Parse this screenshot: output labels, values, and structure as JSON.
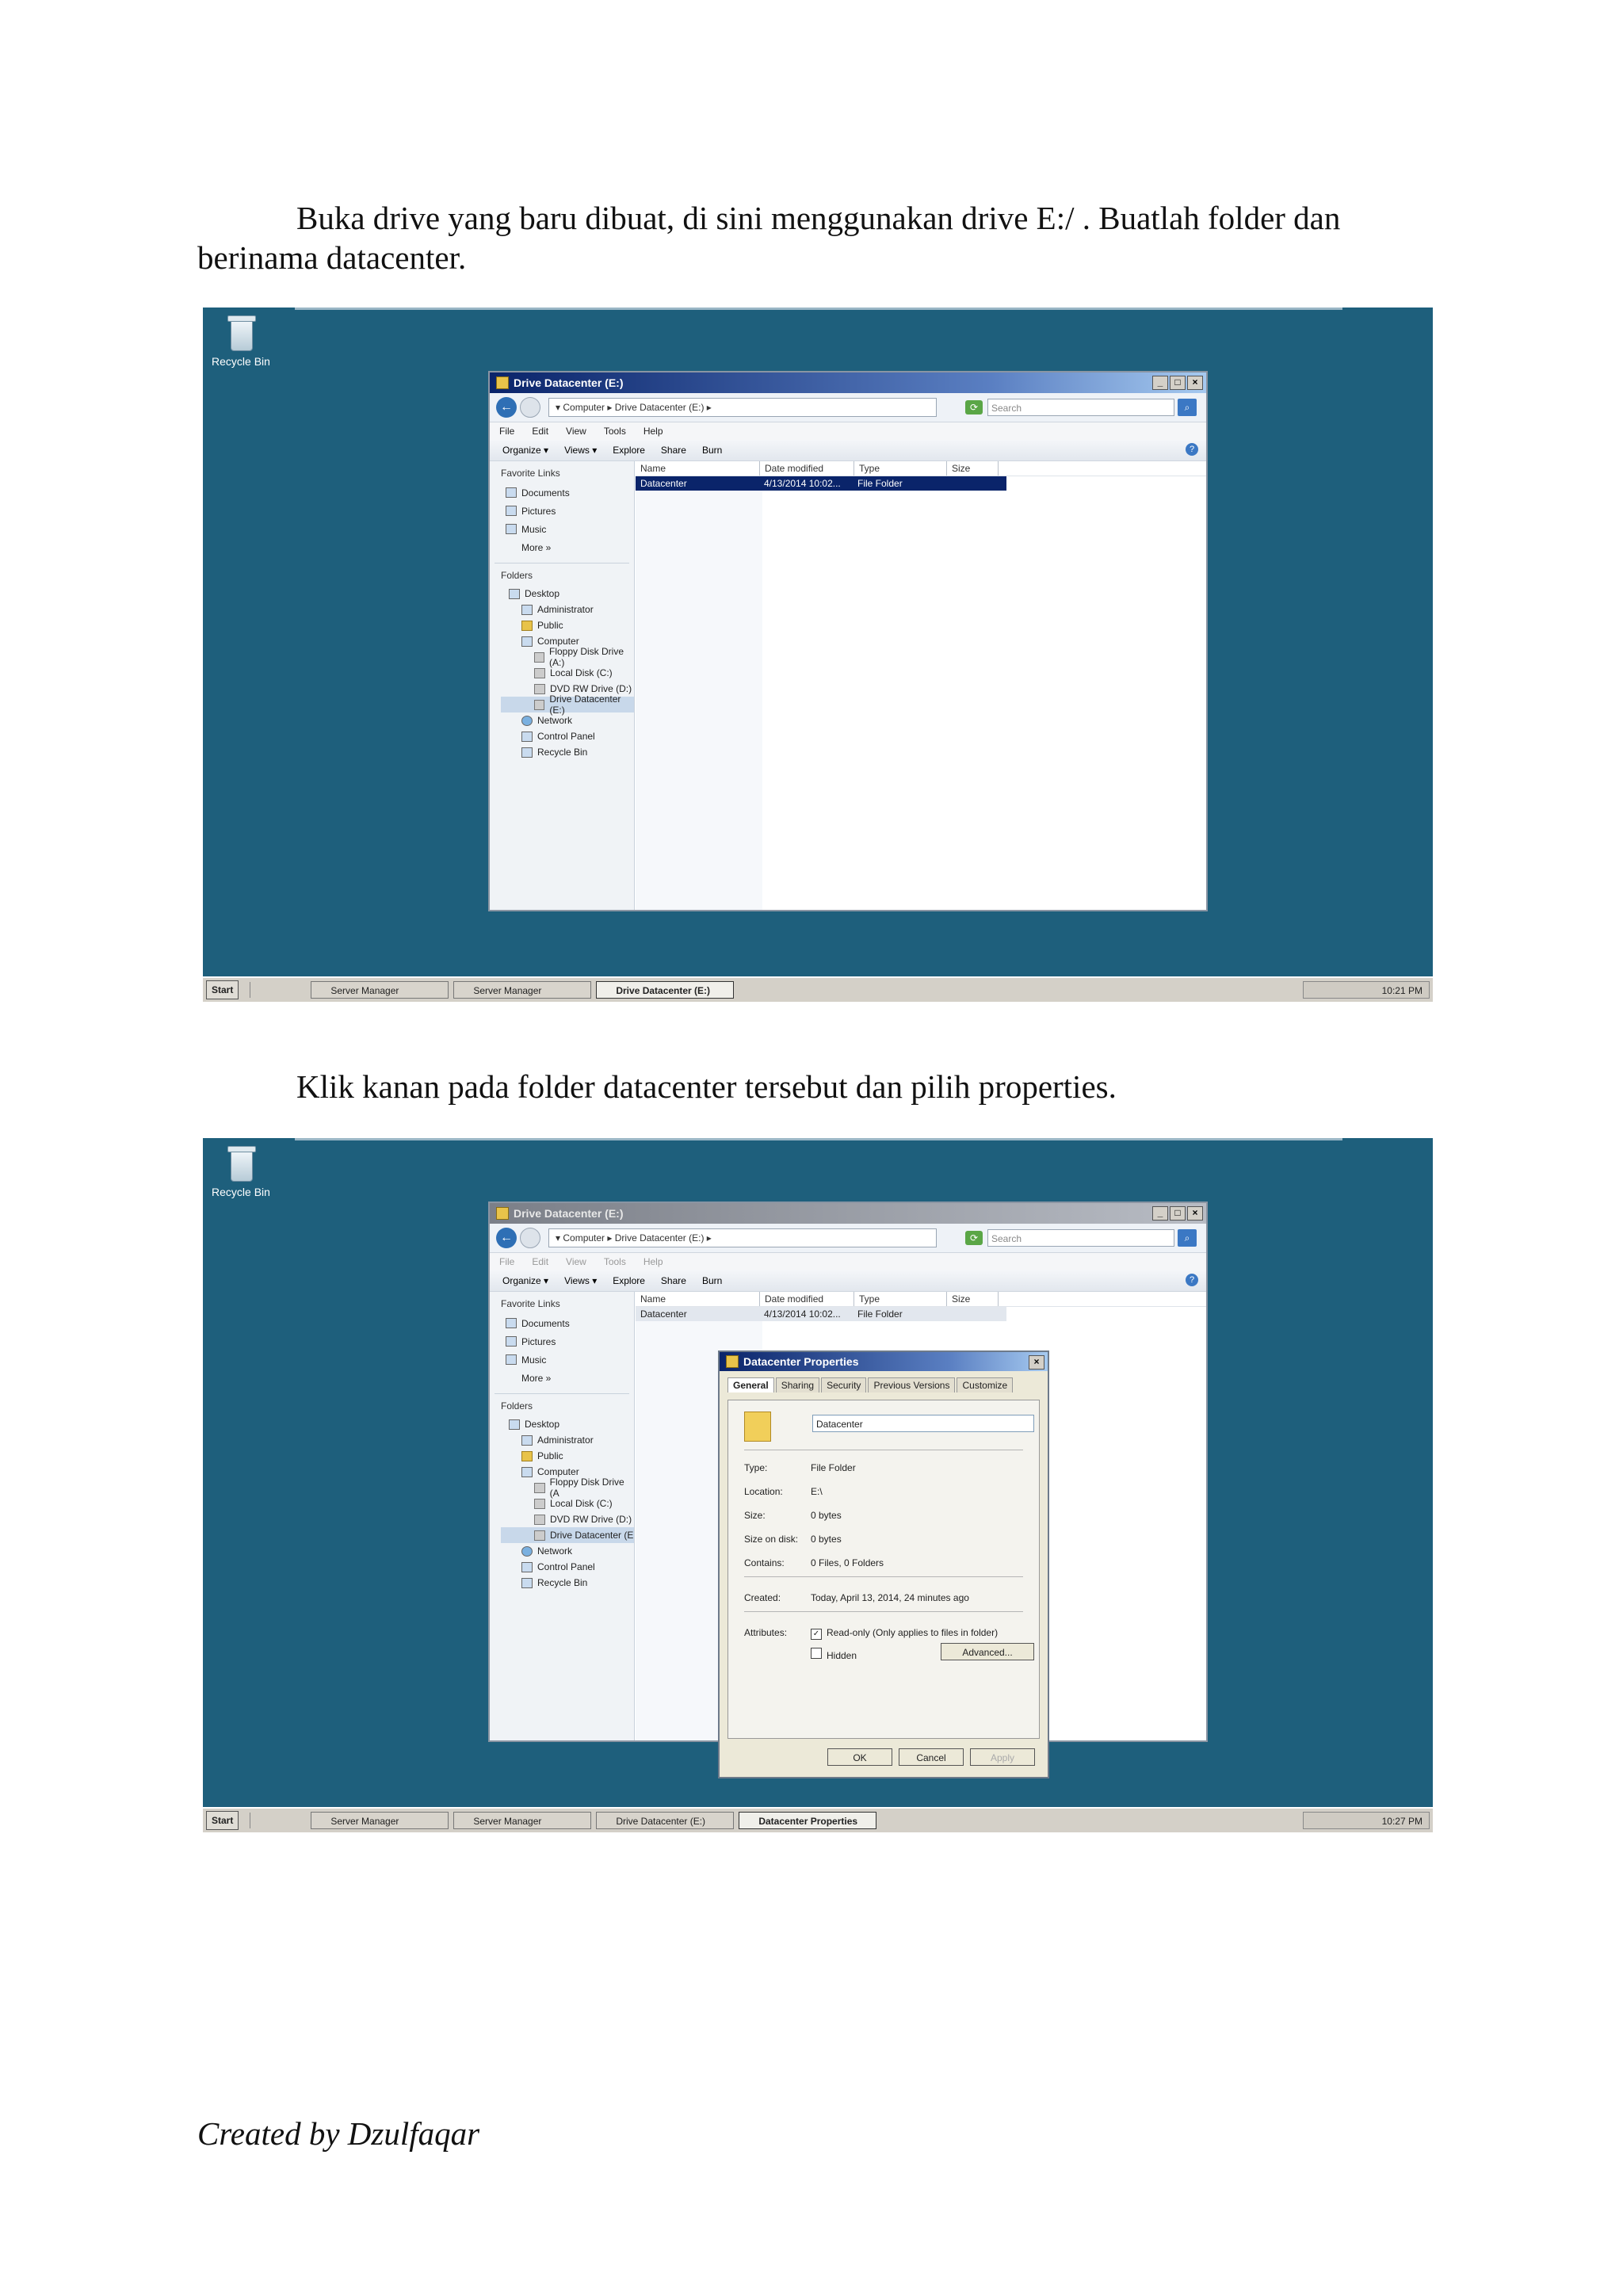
{
  "document": {
    "para1_line1": "Buka drive yang baru dibuat, di sini menggunakan drive E:/ . Buatlah folder dan",
    "para1_line2": "berinama datacenter.",
    "para2": "Klik kanan pada folder datacenter tersebut dan pilih properties.",
    "footer": "Created by Dzulfaqar"
  },
  "desktop": {
    "recycle_bin": "Recycle Bin",
    "background": "#1e5f7c"
  },
  "explorer": {
    "title": "Drive Datacenter (E:)",
    "breadcrumb": "▾ Computer ▸ Drive Datacenter (E:) ▸",
    "search_placeholder": "Search",
    "menu": [
      "File",
      "Edit",
      "View",
      "Tools",
      "Help"
    ],
    "toolbar": [
      "Organize ▾",
      "Views ▾",
      "Explore",
      "Share",
      "Burn"
    ],
    "favorite_links_title": "Favorite Links",
    "favorite_links": [
      "Documents",
      "Pictures",
      "Music",
      "More »"
    ],
    "folders_title": "Folders",
    "tree": [
      "Desktop",
      "Administrator",
      "Public",
      "Computer",
      "Floppy Disk Drive (A:)",
      "Local Disk (C:)",
      "DVD RW Drive (D:)",
      "Drive Datacenter (E:)",
      "Network",
      "Control Panel",
      "Recycle Bin"
    ],
    "tree2": [
      "Desktop",
      "Administrator",
      "Public",
      "Computer",
      "Floppy Disk Drive (A",
      "Local Disk (C:)",
      "DVD RW Drive (D:)",
      "Drive Datacenter (E",
      "Network",
      "Control Panel",
      "Recycle Bin"
    ],
    "columns": [
      "Name",
      "Date modified",
      "Type",
      "Size"
    ],
    "file": {
      "name": "Datacenter",
      "date": "4/13/2014 10:02...",
      "type": "File Folder"
    }
  },
  "taskbar": {
    "start": "Start",
    "items1": [
      "Server Manager",
      "Server Manager",
      "Drive Datacenter (E:)"
    ],
    "items2": [
      "Server Manager",
      "Server Manager",
      "Drive Datacenter (E:)",
      "Datacenter Properties"
    ],
    "time1": "10:21 PM",
    "time2": "10:27 PM"
  },
  "properties": {
    "title": "Datacenter Properties",
    "tabs": [
      "General",
      "Sharing",
      "Security",
      "Previous Versions",
      "Customize"
    ],
    "name": "Datacenter",
    "type_k": "Type:",
    "type_v": "File Folder",
    "location_k": "Location:",
    "location_v": "E:\\",
    "size_k": "Size:",
    "size_v": "0 bytes",
    "sizedisk_k": "Size on disk:",
    "sizedisk_v": "0 bytes",
    "contains_k": "Contains:",
    "contains_v": "0 Files, 0 Folders",
    "created_k": "Created:",
    "created_v": "Today, April 13, 2014, 24 minutes ago",
    "attributes_k": "Attributes:",
    "readonly": "Read-only (Only applies to files in folder)",
    "hidden": "Hidden",
    "advanced": "Advanced...",
    "ok": "OK",
    "cancel": "Cancel",
    "apply": "Apply"
  }
}
